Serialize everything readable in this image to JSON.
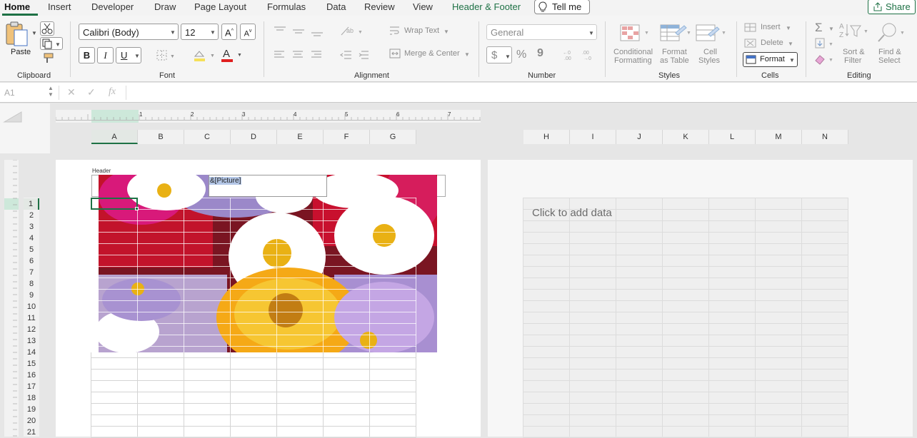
{
  "tabs": [
    {
      "label": "Home",
      "active": true
    },
    {
      "label": "Insert"
    },
    {
      "label": "Developer"
    },
    {
      "label": "Draw"
    },
    {
      "label": "Page Layout"
    },
    {
      "label": "Formulas"
    },
    {
      "label": "Data"
    },
    {
      "label": "Review"
    },
    {
      "label": "View"
    },
    {
      "label": "Header & Footer",
      "contextual": true
    }
  ],
  "tell_me": "Tell me",
  "share": "Share",
  "clipboard": {
    "paste": "Paste",
    "group": "Clipboard"
  },
  "font": {
    "name": "Calibri (Body)",
    "size": "12",
    "bold": "B",
    "italic": "I",
    "underline": "U",
    "group": "Font",
    "grow": "A",
    "shrink": "A",
    "color_letter": "A"
  },
  "alignment": {
    "wrap": "Wrap Text",
    "merge": "Merge & Center",
    "group": "Alignment"
  },
  "number": {
    "format": "General",
    "currency": "$",
    "percent": "%",
    "comma": "9",
    "inc_dec": "←0 .00",
    "dec_dec": ".00 →0",
    "group": "Number"
  },
  "styles": {
    "conditional": "Conditional Formatting",
    "conditional_l1": "Conditional",
    "conditional_l2": "Formatting",
    "table_l1": "Format",
    "table_l2": "as Table",
    "cell_l1": "Cell",
    "cell_l2": "Styles",
    "group": "Styles"
  },
  "cells": {
    "insert": "Insert",
    "delete": "Delete",
    "format": "Format",
    "group": "Cells"
  },
  "editing": {
    "sum": "Σ",
    "sort_l1": "Sort &",
    "sort_l2": "Filter",
    "find_l1": "Find &",
    "find_l2": "Select",
    "group": "Editing"
  },
  "formula_bar": {
    "name_box": "A1",
    "cancel": "✕",
    "enter": "✓",
    "fx": "fx",
    "value": ""
  },
  "ruler": [
    "1",
    "2",
    "3",
    "4",
    "5",
    "6",
    "7"
  ],
  "left_columns": [
    "A",
    "B",
    "C",
    "D",
    "E",
    "F",
    "G"
  ],
  "right_columns": [
    "H",
    "I",
    "J",
    "K",
    "L",
    "M",
    "N"
  ],
  "rows": [
    "1",
    "2",
    "3",
    "4",
    "5",
    "6",
    "7",
    "8",
    "9",
    "10",
    "11",
    "12",
    "13",
    "14",
    "15",
    "16",
    "17",
    "18",
    "19",
    "20",
    "21"
  ],
  "header_label": "Header",
  "header_code": "&[Picture]",
  "click_to_add": "Click to add data",
  "colors": {
    "accent": "#1e7145",
    "header_highlight": "#b4c7e7"
  }
}
